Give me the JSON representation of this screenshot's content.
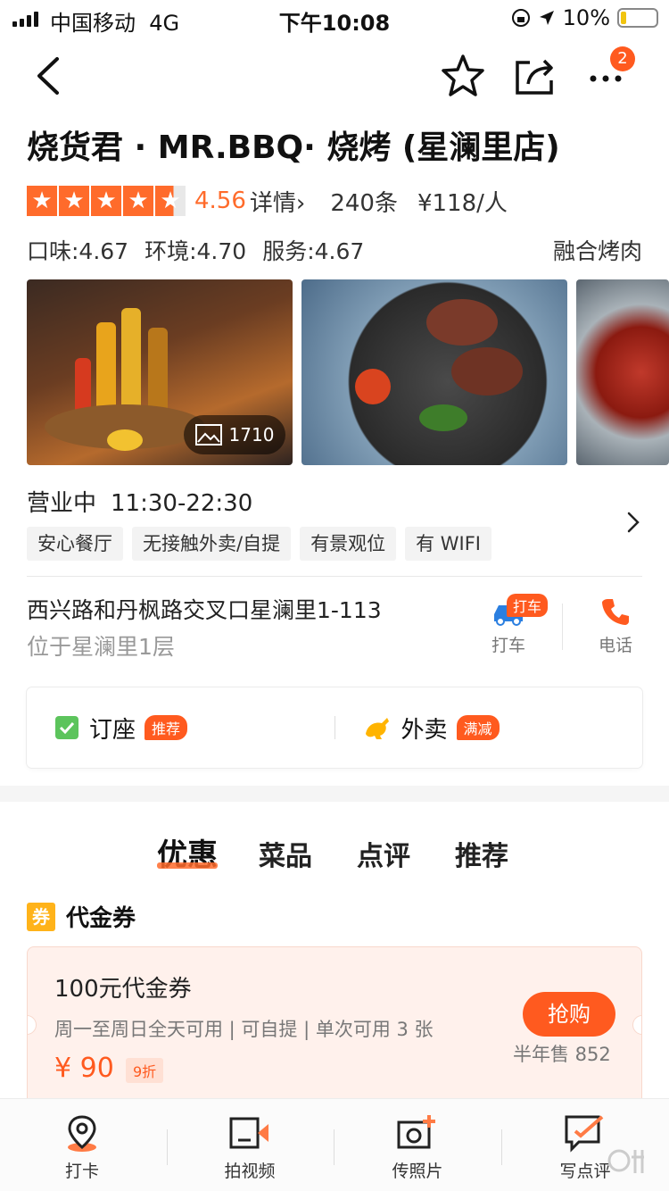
{
  "status_bar": {
    "carrier": "中国移动",
    "network": "4G",
    "time": "下午10:08",
    "battery": "10%"
  },
  "nav": {
    "badge": "2",
    "icons": [
      "back-icon",
      "star-icon",
      "share-icon",
      "more-icon"
    ]
  },
  "shop": {
    "name": "烧货君 · MR.BBQ· 烧烤 (星澜里店)",
    "rating": "4.56",
    "rating_value": 4.56,
    "detail_label": "详情",
    "review_count": "240条",
    "avg_price": "¥118/人",
    "sub_scores": {
      "taste": "口味:4.67",
      "environment": "环境:4.70",
      "service": "服务:4.67"
    },
    "category": "融合烤肉",
    "photo_count": "1710",
    "status": "营业中",
    "hours": "11:30-22:30",
    "tags": [
      "安心餐厅",
      "无接触外卖/自提",
      "有景观位",
      "有 WIFI"
    ],
    "address": "西兴路和丹枫路交叉口星澜里1-113",
    "address_note": "位于星澜里1层",
    "taxi_badge": "打车",
    "taxi_label": "打车",
    "phone_label": "电话"
  },
  "services": {
    "reserve": {
      "label": "订座",
      "pill": "推荐"
    },
    "delivery": {
      "label": "外卖",
      "pill": "满减"
    }
  },
  "tabs": [
    "优惠",
    "菜品",
    "点评",
    "推荐"
  ],
  "coupon_section": {
    "icon_text": "券",
    "title": "代金券",
    "coupon": {
      "name": "100元代金券",
      "desc": "周一至周日全天可用 | 可自提 | 单次可用 3 张",
      "price": "¥ 90",
      "discount": "9折",
      "button": "抢购",
      "sold": "半年售 852"
    }
  },
  "bottom_bar": {
    "checkin": "打卡",
    "video": "拍视频",
    "photo": "传照片",
    "review": "写点评"
  },
  "colors": {
    "accent": "#ff5a1f",
    "star": "#ff6b2b",
    "coupon_bg": "#fff1ec"
  }
}
